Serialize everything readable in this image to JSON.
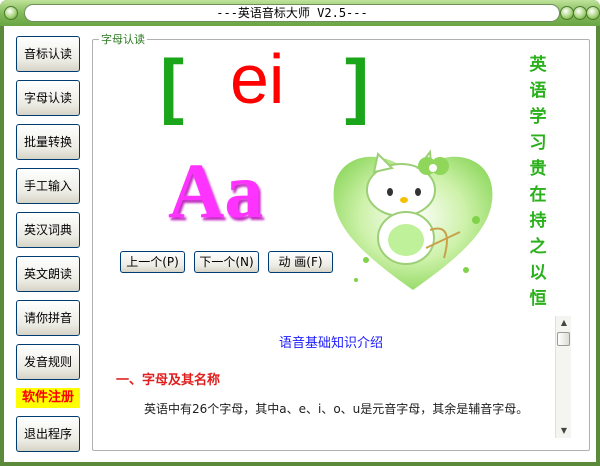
{
  "window": {
    "title": "---英语音标大师 V2.5---"
  },
  "sidebar": {
    "items": [
      {
        "label": "音标认读"
      },
      {
        "label": "字母认读"
      },
      {
        "label": "批量转换"
      },
      {
        "label": "手工输入"
      },
      {
        "label": "英汉词典"
      },
      {
        "label": "英文朗读"
      },
      {
        "label": "请你拼音"
      },
      {
        "label": "发音规则"
      }
    ],
    "register_label": "软件注册",
    "exit_label": "退出程序"
  },
  "main": {
    "group_label": "字母认读",
    "bracket_left": "[",
    "bracket_right": "]",
    "phonetic": "ei",
    "letter": "Aa",
    "motto": [
      "英",
      "语",
      "学",
      "习",
      "贵",
      "在",
      "持",
      "之",
      "以",
      "恒"
    ],
    "buttons": {
      "prev": "上一个(P)",
      "next": "下一个(N)",
      "animate": "动 画(F)"
    }
  },
  "textarea": {
    "title": "语音基础知识介绍",
    "heading": "一、字母及其名称",
    "paragraph": "英语中有26个字母，其中a、e、i、o、u是元音字母，其余是辅音字母。"
  },
  "colors": {
    "title_green": "#7fb857",
    "phonetic_red": "#ff0000",
    "letter_magenta": "#ff33ff",
    "bracket_green": "#1aa51a",
    "motto_green": "#2ab01a",
    "register_yellow": "#ffff00"
  }
}
